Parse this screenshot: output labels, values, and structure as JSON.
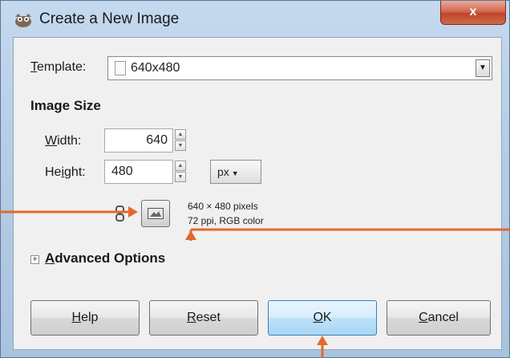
{
  "window": {
    "title": "Create a New Image",
    "close_glyph": "x"
  },
  "template": {
    "label_mnemonic": "T",
    "label_rest": "emplate:",
    "value": "640x480",
    "dropdown_glyph": "▼"
  },
  "image_size": {
    "heading": "Image Size",
    "width_mnemonic": "W",
    "width_rest": "idth:",
    "width_value": "640",
    "height_pre": "He",
    "height_mnemonic": "i",
    "height_post": "ght:",
    "height_value": "480",
    "unit": "px",
    "unit_arrow": "▼",
    "info_line1": "640 × 480 pixels",
    "info_line2": "72 ppi, RGB color"
  },
  "advanced": {
    "expander_glyph": "+",
    "mnemonic": "A",
    "rest": "dvanced Options"
  },
  "buttons": {
    "help_mnemonic": "H",
    "help_rest": "elp",
    "reset_mnemonic": "R",
    "reset_rest": "eset",
    "ok_mnemonic": "O",
    "ok_rest": "K",
    "cancel_mnemonic": "C",
    "cancel_rest": "ancel"
  },
  "callout_color": "#e06a2c",
  "icons": [
    "app-icon",
    "close-icon",
    "document-icon",
    "chain-icon",
    "landscape-icon",
    "expander-icon"
  ]
}
